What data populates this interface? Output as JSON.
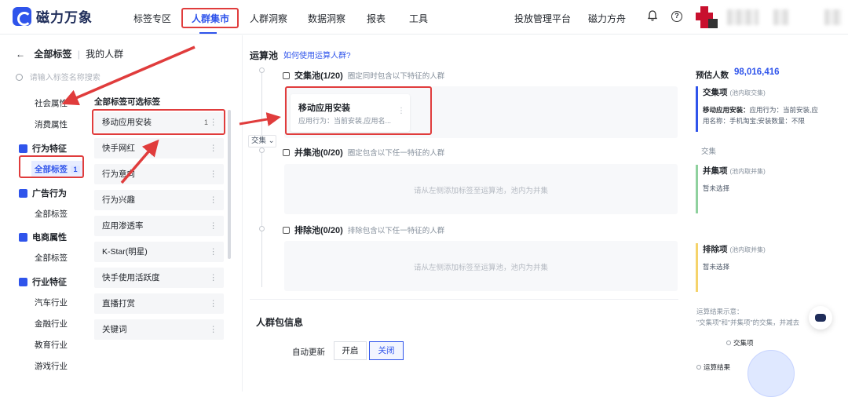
{
  "brand": {
    "name": "磁力万象"
  },
  "nav": {
    "items": [
      "标签专区",
      "人群集市",
      "人群洞察",
      "数据洞察",
      "报表",
      "工具"
    ],
    "active": "人群集市",
    "right_links": [
      "投放管理平台",
      "磁力方舟"
    ]
  },
  "left": {
    "back_label": "全部标签",
    "my_audience": "我的人群",
    "search_placeholder": "请输入标签名称搜索",
    "top_items": [
      "社会属性",
      "消费属性"
    ],
    "categories": [
      {
        "name": "行为特征",
        "subs": [
          {
            "label": "全部标签",
            "count": "1"
          }
        ]
      },
      {
        "name": "广告行为",
        "subs": [
          {
            "label": "全部标签"
          }
        ]
      },
      {
        "name": "电商属性",
        "subs": [
          {
            "label": "全部标签"
          }
        ]
      },
      {
        "name": "行业特征",
        "subs": [
          {
            "label": "汽车行业"
          },
          {
            "label": "金融行业"
          },
          {
            "label": "教育行业"
          },
          {
            "label": "游戏行业"
          }
        ]
      }
    ]
  },
  "middle": {
    "title": "全部标签可选标签",
    "tags": [
      {
        "label": "移动应用安装",
        "count": "1"
      },
      {
        "label": "快手网红"
      },
      {
        "label": "行为意向"
      },
      {
        "label": "行为兴趣"
      },
      {
        "label": "应用渗透率"
      },
      {
        "label": "K-Star(明星)"
      },
      {
        "label": "快手使用活跃度"
      },
      {
        "label": "直播打赏"
      },
      {
        "label": "关键词"
      }
    ]
  },
  "calc": {
    "title": "运算池",
    "help": "如何使用运算人群?",
    "operator": "交集",
    "pools": [
      {
        "name": "交集池(1/20)",
        "desc": "圈定同时包含以下特征的人群"
      },
      {
        "name": "并集池(0/20)",
        "desc": "圈定包含以下任一特征的人群",
        "empty": "请从左侧添加标签至运算池，池内为并集"
      },
      {
        "name": "排除池(0/20)",
        "desc": "排除包含以下任一特征的人群",
        "empty": "请从左侧添加标签至运算池，池内为并集"
      }
    ],
    "chip": {
      "title": "移动应用安装",
      "desc": "应用行为：当前安装,应用名..."
    }
  },
  "package": {
    "title": "人群包信息",
    "auto_update_label": "自动更新",
    "options": [
      "开启",
      "关闭"
    ],
    "selected": "关闭"
  },
  "right": {
    "estimate_label": "预估人数",
    "estimate_value": "98,016,416",
    "intersection": {
      "title": "交集项",
      "note": "(池内取交集)",
      "line1_key": "移动应用安装：",
      "line1_val": "应用行为：当前安装,应",
      "line2": "用名称：手机淘宝;安装数量：不限"
    },
    "op_label": "交集",
    "union": {
      "title": "并集项",
      "note": "(池内取并集)",
      "empty": "暂未选择"
    },
    "exclude": {
      "title": "排除项",
      "note": "(池内取并集)",
      "empty": "暂未选择"
    },
    "legend_line1": "运算结果示意：",
    "legend_line2": "\"交集项\"和\"并集项\"的交集，并减去",
    "venn_a": "交集项",
    "venn_b": "运算结果"
  },
  "colors": {
    "accent": "#2f54eb",
    "highlight": "#e03c3c"
  }
}
